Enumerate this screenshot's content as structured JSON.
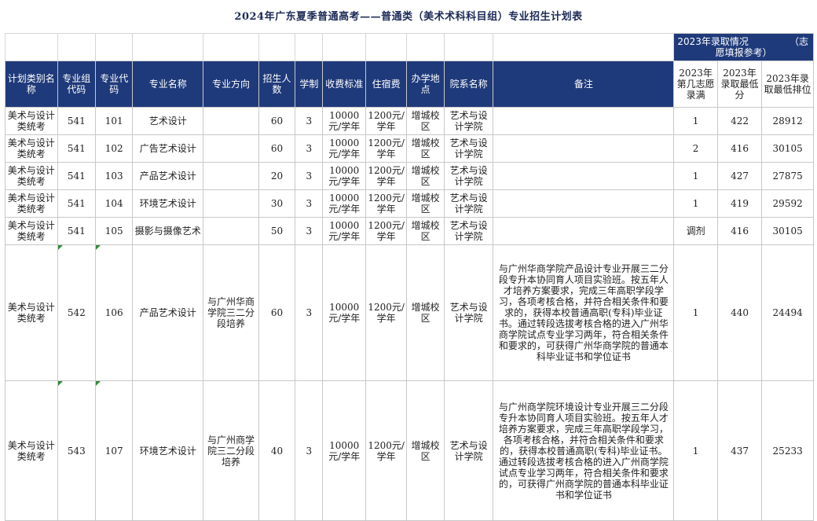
{
  "title": "2024年广东夏季普通高考——普通类（美术术科科目组）专业招生计划表",
  "top_note": {
    "part1": "2023年录取情况",
    "part2": "（志",
    "part3": "愿填报参考）"
  },
  "headers": [
    "计划类别名称",
    "专业组代码",
    "专业代码",
    "专业名称",
    "专业方向",
    "招生人数",
    "学制",
    "收费标准",
    "住宿费",
    "办学地点",
    "院系名称",
    "备注"
  ],
  "headers_2023": [
    "2023年第几志愿录满",
    "2023年录取最低分",
    "2023年录取最低排位"
  ],
  "rows": [
    {
      "category": "美术与设计类统考",
      "group": "541",
      "code": "101",
      "major": "艺术设计",
      "direction": "",
      "quota": "60",
      "years": "3",
      "fee": "10000元/学年",
      "dorm": "1200元/学年",
      "campus": "增城校区",
      "school": "艺术与设计学院",
      "note": "",
      "choice": "1",
      "min_score": "422",
      "min_rank": "28912"
    },
    {
      "category": "美术与设计类统考",
      "group": "541",
      "code": "102",
      "major": "广告艺术设计",
      "direction": "",
      "quota": "60",
      "years": "3",
      "fee": "10000元/学年",
      "dorm": "1200元/学年",
      "campus": "增城校区",
      "school": "艺术与设计学院",
      "note": "",
      "choice": "2",
      "min_score": "416",
      "min_rank": "30105"
    },
    {
      "category": "美术与设计类统考",
      "group": "541",
      "code": "103",
      "major": "产品艺术设计",
      "direction": "",
      "quota": "20",
      "years": "3",
      "fee": "10000元/学年",
      "dorm": "1200元/学年",
      "campus": "增城校区",
      "school": "艺术与设计学院",
      "note": "",
      "choice": "1",
      "min_score": "427",
      "min_rank": "27875"
    },
    {
      "category": "美术与设计类统考",
      "group": "541",
      "code": "104",
      "major": "环境艺术设计",
      "direction": "",
      "quota": "30",
      "years": "3",
      "fee": "10000元/学年",
      "dorm": "1200元/学年",
      "campus": "增城校区",
      "school": "艺术与设计学院",
      "note": "",
      "choice": "1",
      "min_score": "419",
      "min_rank": "29592"
    },
    {
      "category": "美术与设计类统考",
      "group": "541",
      "code": "105",
      "major": "摄影与摄像艺术",
      "direction": "",
      "quota": "50",
      "years": "3",
      "fee": "10000元/学年",
      "dorm": "1200元/学年",
      "campus": "增城校区",
      "school": "艺术与设计学院",
      "note": "",
      "choice": "调剂",
      "min_score": "416",
      "min_rank": "30105"
    },
    {
      "category": "美术与设计类统考",
      "group": "542",
      "code": "106",
      "major": "产品艺术设计",
      "direction": "与广州华商学院三二分段培养",
      "quota": "60",
      "years": "3",
      "fee": "10000元/学年",
      "dorm": "1200元/学年",
      "campus": "增城校区",
      "school": "艺术与设计学院",
      "note": "与广州华商学院产品设计专业开展三二分段专升本协同育人项目实验班。按五年人才培养方案要求，完成三年高职学段学习，各项考核合格，并符合相关条件和要求的，获得本校普通高职(专科)毕业证书。通过转段选拔考核合格的进入广州华商学院试点专业学习两年，符合相关条件和要求的，可获得广州华商学院的普通本科毕业证书和学位证书",
      "choice": "1",
      "min_score": "440",
      "min_rank": "24494"
    },
    {
      "category": "美术与设计类统考",
      "group": "543",
      "code": "107",
      "major": "环境艺术设计",
      "direction": "与广州商学院三二分段培养",
      "quota": "40",
      "years": "3",
      "fee": "10000元/学年",
      "dorm": "1200元/学年",
      "campus": "增城校区",
      "school": "艺术与设计学院",
      "note": "与广州商学院环境设计专业开展三二分段专升本协同育人项目实验班。按五年人才培养方案要求，完成三年高职学段学习，各项考核合格，并符合相关条件和要求的，获得本校普通高职(专科)毕业证书。通过转段选拔考核合格的进入广州商学院试点专业学习两年，符合相关条件和要求的，可获得广州商学院的普通本科毕业证书和学位证书",
      "choice": "1",
      "min_score": "437",
      "min_rank": "25233"
    }
  ]
}
